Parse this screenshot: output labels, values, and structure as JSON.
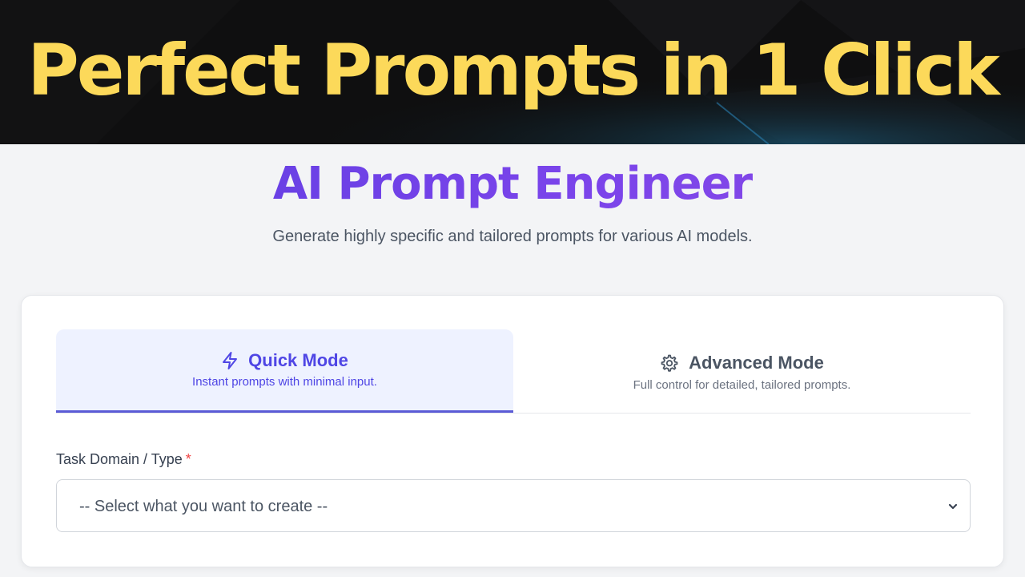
{
  "banner": {
    "headline": "Perfect Prompts in 1 Click",
    "headline_color": "#fcd95a",
    "background_color": "#0f0f10"
  },
  "app": {
    "title": "AI Prompt Engineer",
    "subtitle": "Generate highly specific and tailored prompts for various AI models.",
    "accent_color": "#6b3fe3"
  },
  "mode_tabs": [
    {
      "label": "Quick Mode",
      "description": "Instant prompts with minimal input.",
      "icon": "lightning-bolt-icon",
      "active": true
    },
    {
      "label": "Advanced Mode",
      "description": "Full control for detailed, tailored prompts.",
      "icon": "gear-icon",
      "active": false
    }
  ],
  "task_field": {
    "label": "Task Domain / Type",
    "required_marker": "*",
    "selected_value": "-- Select what you want to create --",
    "icon": "chevron-down-icon"
  }
}
